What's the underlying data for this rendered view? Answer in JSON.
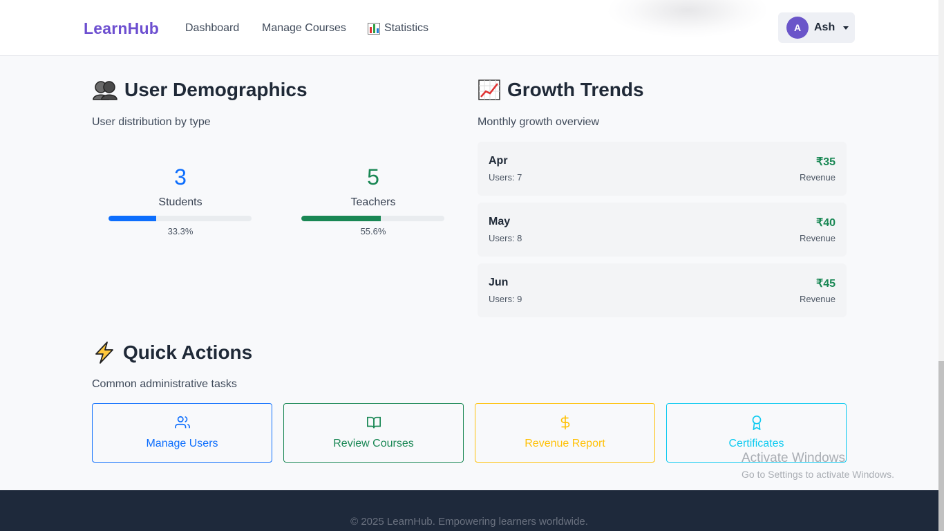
{
  "nav": {
    "brand": "LearnHub",
    "links": [
      {
        "label": "Dashboard"
      },
      {
        "label": "Manage Courses"
      },
      {
        "label": "Statistics",
        "icon": "bar-chart-icon"
      }
    ],
    "user": {
      "initial": "A",
      "name": "Ash"
    }
  },
  "demographics": {
    "title": "User Demographics",
    "icon": "users-emoji-icon",
    "subtitle": "User distribution by type",
    "stats": [
      {
        "value": "3",
        "label": "Students",
        "percent": "33.3%",
        "fraction": 0.333,
        "color": "#0d6efd"
      },
      {
        "value": "5",
        "label": "Teachers",
        "percent": "55.6%",
        "fraction": 0.556,
        "color": "#198754"
      }
    ]
  },
  "growth": {
    "title": "Growth Trends",
    "icon": "chart-increasing-icon",
    "subtitle": "Monthly growth overview",
    "months": [
      {
        "month": "Apr",
        "users": "Users: 7",
        "amount": "₹35",
        "revenue_label": "Revenue"
      },
      {
        "month": "May",
        "users": "Users: 8",
        "amount": "₹40",
        "revenue_label": "Revenue"
      },
      {
        "month": "Jun",
        "users": "Users: 9",
        "amount": "₹45",
        "revenue_label": "Revenue"
      }
    ]
  },
  "quick_actions": {
    "title": "Quick Actions",
    "icon": "lightning-icon",
    "subtitle": "Common administrative tasks",
    "actions": [
      {
        "label": "Manage Users",
        "icon": "users-icon",
        "color": "#0d6efd"
      },
      {
        "label": "Review Courses",
        "icon": "book-icon",
        "color": "#198754"
      },
      {
        "label": "Revenue Report",
        "icon": "dollar-icon",
        "color": "#ffc107"
      },
      {
        "label": "Certificates",
        "icon": "award-icon",
        "color": "#0dcaf0"
      }
    ]
  },
  "watermark": {
    "title": "Activate Windows",
    "subtitle": "Go to Settings to activate Windows."
  },
  "footer": {
    "text": "© 2025 LearnHub. Empowering learners worldwide."
  },
  "colors": {
    "brand": "#6d4fd0",
    "footer_bg": "#1e293b",
    "success": "#198754",
    "primary": "#0d6efd"
  }
}
